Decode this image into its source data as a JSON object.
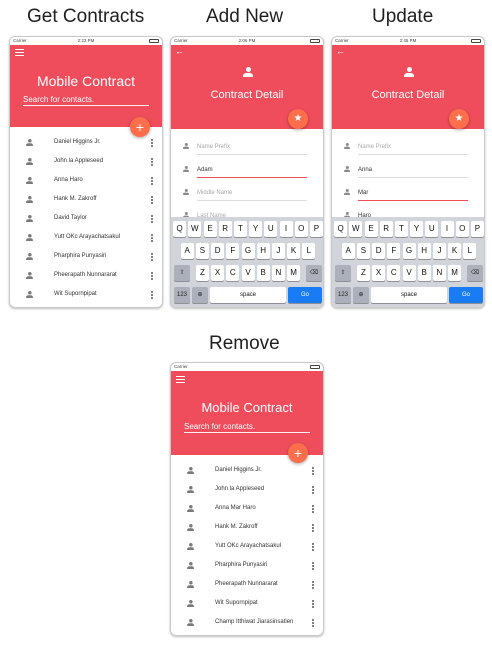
{
  "captions": {
    "get": "Get Contracts",
    "add": "Add New",
    "update": "Update",
    "remove": "Remove"
  },
  "status_bar": {
    "carrier": "Carrier",
    "time_get": "2:23 PM",
    "time_add": "2:06 PM",
    "time_update": "2:45 PM"
  },
  "list_screen": {
    "title": "Mobile Contract",
    "search_placeholder": "Search for contacts.",
    "fab_label": "+",
    "contacts": [
      "Daniel Higgins Jr.",
      "John la Appleseed",
      "Anna Haro",
      "Hank M. Zakroff",
      "David Taylor",
      "Yutt OKc Arayachatsakul",
      "Pharphira Punyasiri",
      "Pheerapath Nunnararat",
      "Wit Supornpipat"
    ]
  },
  "add_screen": {
    "title": "Contract Detail",
    "fields": [
      {
        "value": "",
        "placeholder": "Name Prefix"
      },
      {
        "value": "Adam",
        "placeholder": ""
      },
      {
        "value": "",
        "placeholder": "Middle Name"
      },
      {
        "value": "",
        "placeholder": "Last Name"
      }
    ]
  },
  "update_screen": {
    "title": "Contract Detail",
    "fields": [
      {
        "value": "",
        "placeholder": "Name Prefix"
      },
      {
        "value": "Anna",
        "placeholder": ""
      },
      {
        "value": "Mar",
        "placeholder": ""
      },
      {
        "value": "Haro",
        "placeholder": ""
      }
    ]
  },
  "keyboard": {
    "row1": [
      "Q",
      "W",
      "E",
      "R",
      "T",
      "Y",
      "U",
      "I",
      "O",
      "P"
    ],
    "row2": [
      "A",
      "S",
      "D",
      "F",
      "G",
      "H",
      "J",
      "K",
      "L"
    ],
    "row3": [
      "Z",
      "X",
      "C",
      "V",
      "B",
      "N",
      "M"
    ],
    "shift": "⇧",
    "delete": "⌫",
    "numbers": "123",
    "globe": "⊕",
    "space": "space",
    "go": "Go"
  },
  "remove_screen": {
    "title": "Mobile Contract",
    "search_placeholder": "Search for contacts.",
    "fab_label": "+",
    "contacts": [
      "Daniel Higgins Jr.",
      "John la Appleseed",
      "Anna Mar Haro",
      "Hank M. Zakroff",
      "Yutt OKc Arayachatsakul",
      "Pharphira Punyasiri",
      "Pheerapath Nunnararat",
      "Wit Supornpipat",
      "Champ Itthiwat Jiarasinsatien"
    ]
  },
  "colors": {
    "header": "#f04d5c",
    "fab": "#ff6e4a",
    "go_key": "#1a7cf5"
  }
}
